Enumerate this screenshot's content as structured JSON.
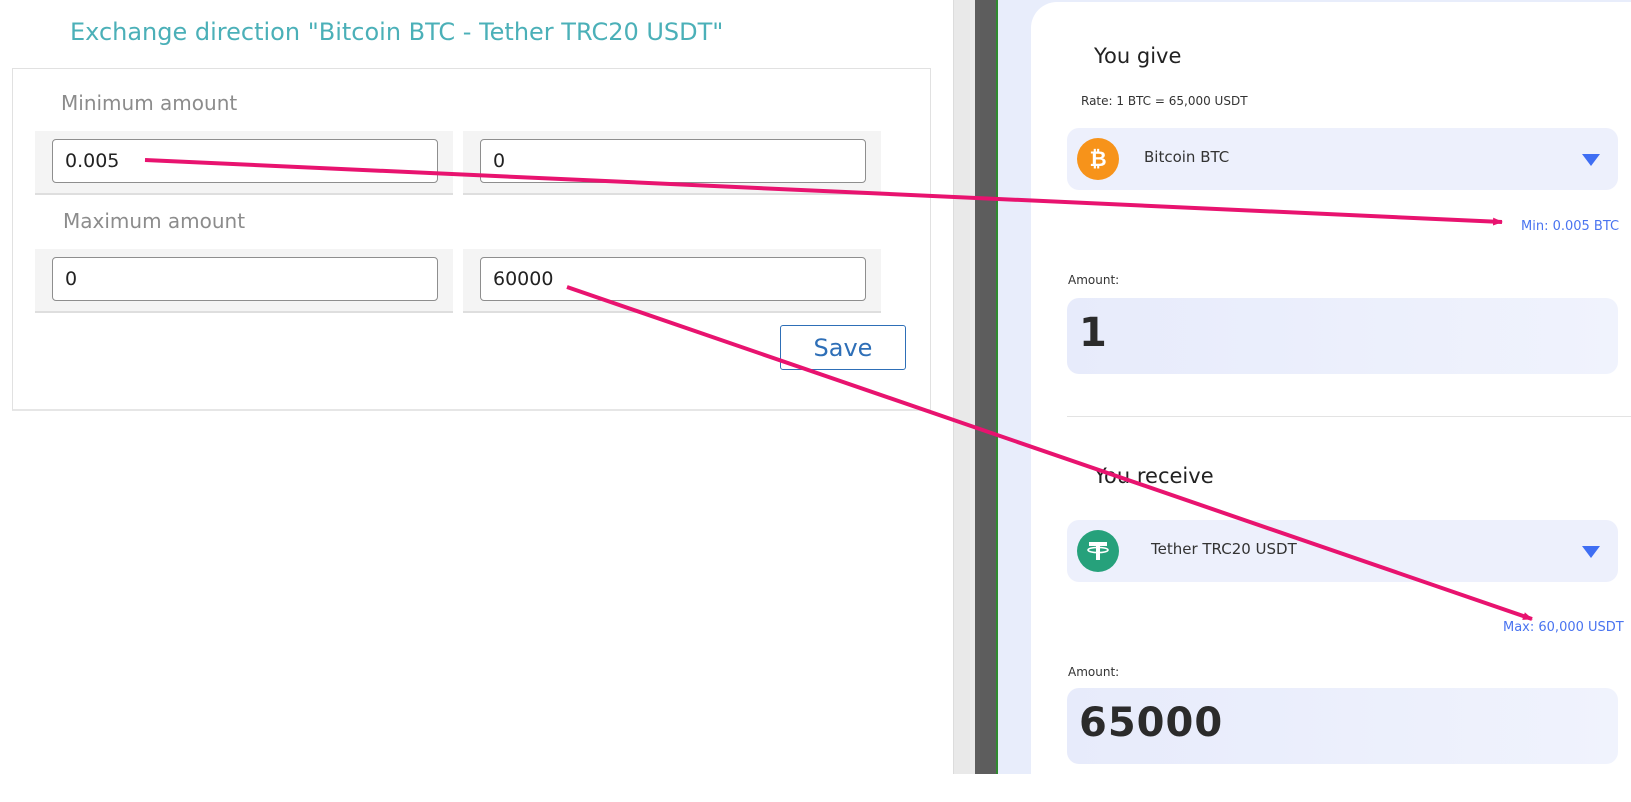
{
  "admin": {
    "title": "Exchange direction \"Bitcoin BTC - Tether TRC20 USDT\"",
    "min_label": "Minimum amount",
    "min_give": "0.005",
    "min_receive": "0",
    "max_label": "Maximum amount",
    "max_give": "0",
    "max_receive": "60000",
    "save_label": "Save"
  },
  "widget": {
    "give_heading": "You give",
    "rate": "Rate: 1 BTC = 65,000 USDT",
    "give_currency": "Bitcoin BTC",
    "min_hint": "Min: 0.005 BTC",
    "amount_label": "Amount:",
    "give_amount": "1",
    "receive_heading": "You receive",
    "receive_currency": "Tether TRC20 USDT",
    "max_hint": "Max: 60,000 USDT",
    "receive_amount_label": "Amount:",
    "receive_amount": "65000"
  },
  "colors": {
    "title": "#4bb0b8",
    "accent_blue": "#3f6ef3",
    "annotation_arrow": "#e8136f",
    "btc": "#f7931a",
    "usdt": "#26a17b"
  },
  "icons": [
    "bitcoin-icon",
    "tether-icon",
    "caret-down-icon"
  ]
}
